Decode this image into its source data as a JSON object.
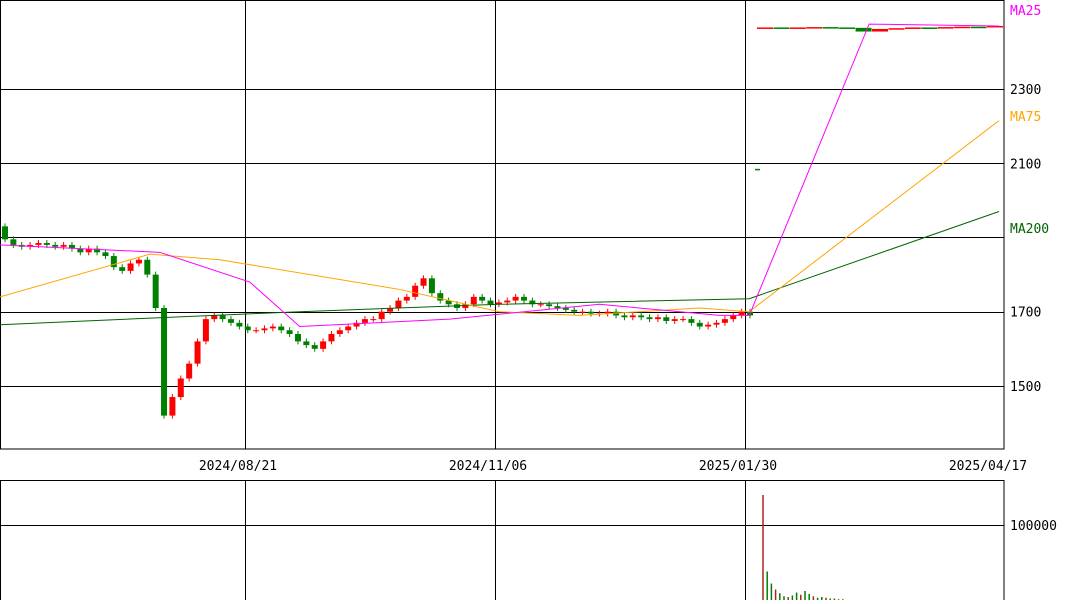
{
  "chart_data": [
    {
      "type": "candlestick",
      "title": "",
      "x_tick_labels": [
        "2024/08/21",
        "2024/11/06",
        "2025/01/30",
        "2025/04/17"
      ],
      "y_tick_labels": [
        "1500",
        "1700",
        "2100",
        "2300"
      ],
      "ylim": [
        1330,
        2540
      ],
      "grid": true,
      "colors": {
        "up": "#ff0000",
        "down": "#008000",
        "ma25": "#ff00ff",
        "ma75": "#ffa500",
        "ma200": "#006400"
      },
      "series_labels": {
        "ma25": "MA25",
        "ma75": "MA75",
        "ma200": "MA200"
      },
      "candles_a_start": [
        1930,
        1895,
        1880,
        1875,
        1880,
        1885,
        1880,
        1875,
        1880,
        1870,
        1860,
        1870,
        1860,
        1850,
        1820,
        1810,
        1830,
        1840,
        1800,
        1710,
        1420,
        1470,
        1520,
        1560,
        1620,
        1680,
        1690,
        1680,
        1670,
        1660,
        1650,
        1650,
        1655,
        1660,
        1650,
        1640,
        1620,
        1610,
        1600,
        1620,
        1640,
        1650,
        1660,
        1670,
        1680,
        1680,
        1700,
        1710,
        1730,
        1740,
        1770,
        1790,
        1750,
        1730,
        1720,
        1710,
        1720,
        1740,
        1730,
        1720,
        1725,
        1730,
        1740,
        1730,
        1720,
        1720,
        1715,
        1710,
        1705,
        1700,
        1700,
        1695,
        1695,
        1700,
        1690,
        1685,
        1690,
        1685,
        1680,
        1685,
        1675,
        1680,
        1680,
        1670,
        1660,
        1665,
        1670,
        1680,
        1690,
        1700
      ],
      "candles_a_end": [
        1895,
        1880,
        1875,
        1880,
        1885,
        1880,
        1875,
        1880,
        1870,
        1860,
        1870,
        1860,
        1850,
        1820,
        1810,
        1830,
        1840,
        1800,
        1710,
        1420,
        1470,
        1520,
        1560,
        1620,
        1680,
        1690,
        1680,
        1670,
        1660,
        1650,
        1650,
        1655,
        1660,
        1650,
        1640,
        1620,
        1610,
        1600,
        1620,
        1640,
        1650,
        1660,
        1670,
        1680,
        1680,
        1700,
        1710,
        1730,
        1740,
        1770,
        1790,
        1750,
        1730,
        1720,
        1710,
        1720,
        1740,
        1730,
        1720,
        1725,
        1730,
        1740,
        1730,
        1720,
        1720,
        1715,
        1710,
        1705,
        1700,
        1700,
        1695,
        1695,
        1700,
        1690,
        1685,
        1690,
        1685,
        1680,
        1685,
        1675,
        1680,
        1680,
        1670,
        1660,
        1665,
        1670,
        1680,
        1690,
        1700,
        1690
      ],
      "candles_b_start": [
        2465,
        2466,
        2465,
        2466,
        2467,
        2466,
        2465,
        2455,
        2462,
        2464,
        2466,
        2465,
        2467,
        2468,
        2466
      ],
      "candles_b_end": [
        2466,
        2465,
        2466,
        2467,
        2466,
        2465,
        2455,
        2462,
        2464,
        2466,
        2465,
        2467,
        2468,
        2466,
        2470
      ],
      "stray_value": 2085,
      "ma25": {
        "x": [
          0,
          0.16,
          0.25,
          0.3,
          0.45,
          0.6,
          0.72,
          0.75,
          0.87,
          1.0
        ],
        "values": [
          1880,
          1860,
          1780,
          1660,
          1680,
          1720,
          1690,
          1690,
          2475,
          2470
        ]
      },
      "ma75": {
        "x": [
          0,
          0.15,
          0.22,
          0.4,
          0.5,
          0.58,
          0.7,
          0.75,
          1.0
        ],
        "values": [
          1740,
          1855,
          1840,
          1760,
          1700,
          1690,
          1710,
          1700,
          2215
        ]
      },
      "ma200": {
        "x": [
          0,
          0.3,
          0.5,
          0.75,
          1.0
        ],
        "values": [
          1665,
          1700,
          1720,
          1735,
          1970
        ]
      }
    },
    {
      "type": "bar",
      "title": "",
      "y_tick_labels": [
        "100000"
      ],
      "ylim": [
        0,
        160000
      ],
      "volume_values": [
        140000,
        38000,
        22000,
        14000,
        9000,
        5000,
        4000,
        6000,
        10000,
        7000,
        12000,
        8000,
        5000,
        3000,
        4000,
        3000,
        2000,
        2000,
        1000,
        1000
      ],
      "colors": {
        "bar": "#b22222",
        "grid": "#000000"
      }
    }
  ]
}
